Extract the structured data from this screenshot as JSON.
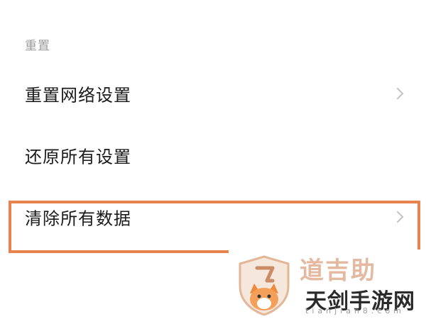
{
  "section": {
    "title": "重置"
  },
  "items": [
    {
      "label": "重置网络设置",
      "chevron": "chevron-right-icon"
    },
    {
      "label": "还原所有设置"
    },
    {
      "label": "清除所有数据",
      "chevron": "chevron-right-icon"
    }
  ],
  "highlight": {
    "color": "#e8834e"
  },
  "watermark": {
    "brand": "天剑手游网",
    "url": "tianjian8.com",
    "logo": "shield-fox-logo"
  }
}
